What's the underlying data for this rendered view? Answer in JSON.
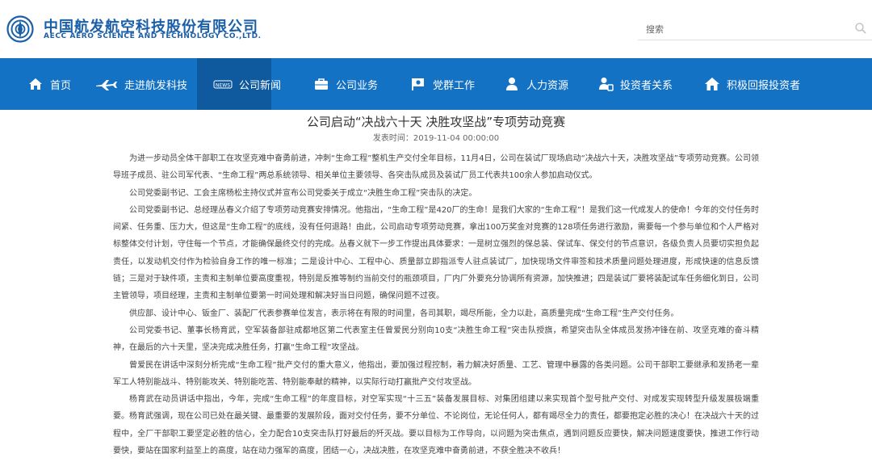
{
  "header": {
    "company_name_cn": "中国航发航空科技股份有限公司",
    "company_name_en": "AECC AERO SCIENCE AND TECHNOLOGY CO.,LTD.",
    "logo_icon": "aecc-logo",
    "search_placeholder": "搜索",
    "search_icon": "search-icon"
  },
  "nav": {
    "items": [
      {
        "label": "首页",
        "icon": "home-icon"
      },
      {
        "label": "走进航发科技",
        "icon": "airplane-icon"
      },
      {
        "label": "公司新闻",
        "icon": "news-icon",
        "active": true
      },
      {
        "label": "公司业务",
        "icon": "briefcase-icon"
      },
      {
        "label": "党群工作",
        "icon": "party-flag-icon"
      },
      {
        "label": "人力资源",
        "icon": "person-icon"
      },
      {
        "label": "投资者关系",
        "icon": "investor-icon"
      },
      {
        "label": "积极回报投资者",
        "icon": "house-icon"
      }
    ],
    "colors": {
      "background": "#1472c4",
      "active": "#0f5a9e"
    }
  },
  "article": {
    "title": "公司启动“决战六十天 决胜攻坚战”专项劳动竞赛",
    "publish_label": "发表时间：2019-11-04 00:00:00",
    "paragraphs": [
      "为进一步动员全体干部职工在攻坚克难中奋勇前进，冲刺“生命工程”整机生产交付全年目标，11月4日，公司在装试厂现场启动“决战六十天，决胜攻坚战”专项劳动竞赛。公司领导班子成员、驻公司军代表、“生命工程”两总系统领导、相关单位主要领导、各突击队成员及装试厂员工代表共100余人参加启动仪式。",
      "公司党委副书记、工会主席杨松主持仪式并宣布公司党委关于成立“决胜生命工程”突击队的决定。",
      "公司党委副书记、总经理丛春义介绍了专项劳动竞赛安排情况。他指出，“生命工程”是420厂的生命！是我们大家的“生命工程”！是我们这一代成发人的使命！今年的交付任务时间紧、任务重、压力大，但这是“生命工程”的底线，没有任何退路！由此，公司启动专项劳动竞赛，拿出100万奖金对竞赛的128项任务进行激励，需要每一个参与单位和个人严格对标整体交付计划，守住每一个节点，才能确保最终交付的完成。丛春义就下一步工作提出具体要求：一是树立强烈的保总装、保试车、保交付的节点意识，各级负责人员要切实担负起责任，以发动机交付作为检验自身工作的唯一标准；二是设计中心、工程中心、质量部立即指派专人驻点装试厂，加快现场文件审签和技术质量问题处理进度，形成快速的信息反馈链；三是对于缺件项，主责和主制单位要高度重视，特别是反推等制约当前交付的瓶颈项目，厂内厂外要充分协调所有资源，加快推进；四是装试厂要将装配试车任务细化到日，公司主管领导，项目经理，主责和主制单位要第一时间处理和解决好当日问题，确保问题不过夜。",
      "供应部、设计中心、钣金厂、装配厂代表参赛单位发言，表示将在有限的时间里，各司其职，竭尽所能，全力以赴，高质量完成“生命工程”生产交付任务。",
      "公司党委书记、董事长杨育武，空军装备部驻成都地区第二代表室主任曾爱民分别向10支“决胜生命工程”突击队授旗，希望突击队全体成员发扬冲锋在前、攻坚克难的奋斗精神，在最后的六十天里，坚决完成决胜任务，打赢“生命工程”攻坚战。",
      "曾爱民在讲话中深刻分析完成“生命工程”批产交付的重大意义，他指出，要加强过程控制，着力解决好质量、工艺、管理中暴露的各类问题。公司干部职工要继承和发扬老一辈军工人特别能战斗、特别能攻关、特别能吃苦、特别能奉献的精神，以实际行动打赢批产交付攻坚战。",
      "杨育武在动员讲话中指出，今年，完成“生命工程”的年度目标，对空军实现“十三五”装备发展目标、对集团组建以来实现首个型号批产交付、对成发实现转型升级发展极端重要。杨育武强调，现在公司已处在最关键、最重要的发展阶段，面对交付任务，要不分单位、不论岗位，无论任何人，都有竭尽全力的责任，都要抱定必胜的决心！在决战六十天的过程中，全厂干部职工要坚定必胜的信心，全力配合10支突击队打好最后的歼灭战。要以目标为工作导向，以问题为突击焦点，遇到问题反应要快，解决问题速度要快，推进工作行动要快，要站在国家利益至上的高度，站在动力强军的高度，团结一心，决战决胜，在攻坚克难中奋勇前进，不获全胜决不收兵！"
    ]
  }
}
